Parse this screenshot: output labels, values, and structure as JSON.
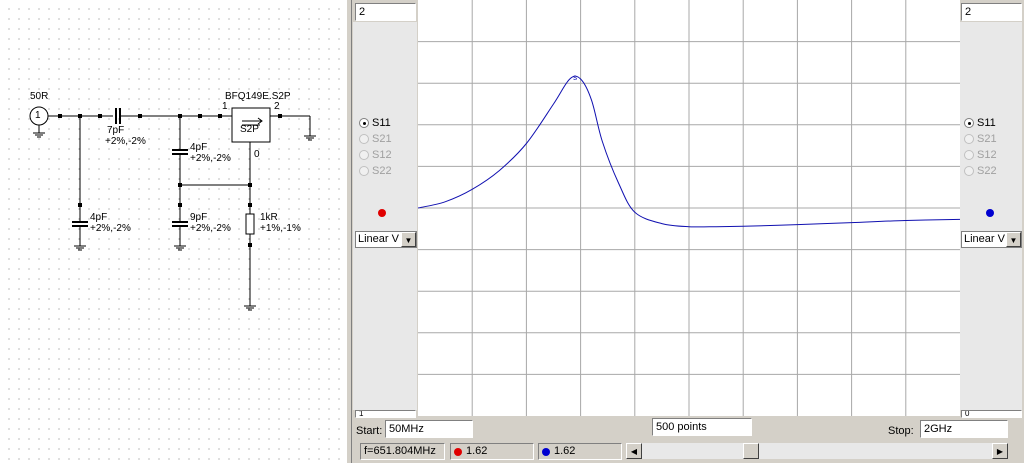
{
  "schematic": {
    "port_label": "50R",
    "port_number": "1",
    "c_series": {
      "value": "7pF",
      "tol": "+2%,-2%"
    },
    "c_shunt1": {
      "value": "4pF",
      "tol": "+2%,-2%"
    },
    "c_shunt2": {
      "value": "4pF",
      "tol": "+2%,-2%"
    },
    "c_shunt3": {
      "value": "9pF",
      "tol": "+2%,-2%"
    },
    "r_shunt": {
      "value": "1kR",
      "tol": "+1%,-1%"
    },
    "transistor": {
      "name": "BFQ149E.S2P",
      "block": "S2P",
      "pin1": "1",
      "pin2": "2",
      "pin0": "0"
    }
  },
  "plot": {
    "left_scale_top": "2",
    "right_scale_top": "2",
    "left_scale_bottom": "1",
    "right_scale_bottom": "0",
    "marker_label": "s",
    "left_params": [
      {
        "label": "S11",
        "checked": true,
        "enabled": true
      },
      {
        "label": "S21",
        "checked": false,
        "enabled": false
      },
      {
        "label": "S12",
        "checked": false,
        "enabled": false
      },
      {
        "label": "S22",
        "checked": false,
        "enabled": false
      }
    ],
    "right_params": [
      {
        "label": "S11",
        "checked": true,
        "enabled": true
      },
      {
        "label": "S21",
        "checked": false,
        "enabled": false
      },
      {
        "label": "S12",
        "checked": false,
        "enabled": false
      },
      {
        "label": "S22",
        "checked": false,
        "enabled": false
      }
    ],
    "left_mode": "Linear V",
    "right_mode": "Linear V",
    "left_dot_color": "#e00000",
    "right_dot_color": "#0000d0",
    "trace_color": "#1010b0"
  },
  "controls": {
    "start_label": "Start:",
    "start_value": "50MHz",
    "points_value": "500 points",
    "stop_label": "Stop:",
    "stop_value": "2GHz"
  },
  "status": {
    "frequency": "f=651.804MHz",
    "left_value": "1.62",
    "right_value": "1.62"
  },
  "chart_data": {
    "type": "line",
    "xlim": [
      0,
      10
    ],
    "ylim": [
      0,
      2
    ],
    "grid": true,
    "series": [
      {
        "x": [
          0,
          0.5,
          1.0,
          1.5,
          2.0,
          2.5,
          2.8,
          3.0,
          3.2,
          3.4,
          3.7,
          4.0,
          4.5,
          5.0,
          5.5,
          6.0,
          7.0,
          8.0,
          9.0,
          10.0
        ],
        "values": [
          1.0,
          1.03,
          1.09,
          1.18,
          1.31,
          1.5,
          1.62,
          1.62,
          1.52,
          1.32,
          1.12,
          0.98,
          0.925,
          0.91,
          0.91,
          0.912,
          0.92,
          0.93,
          0.94,
          0.945
        ]
      }
    ]
  }
}
